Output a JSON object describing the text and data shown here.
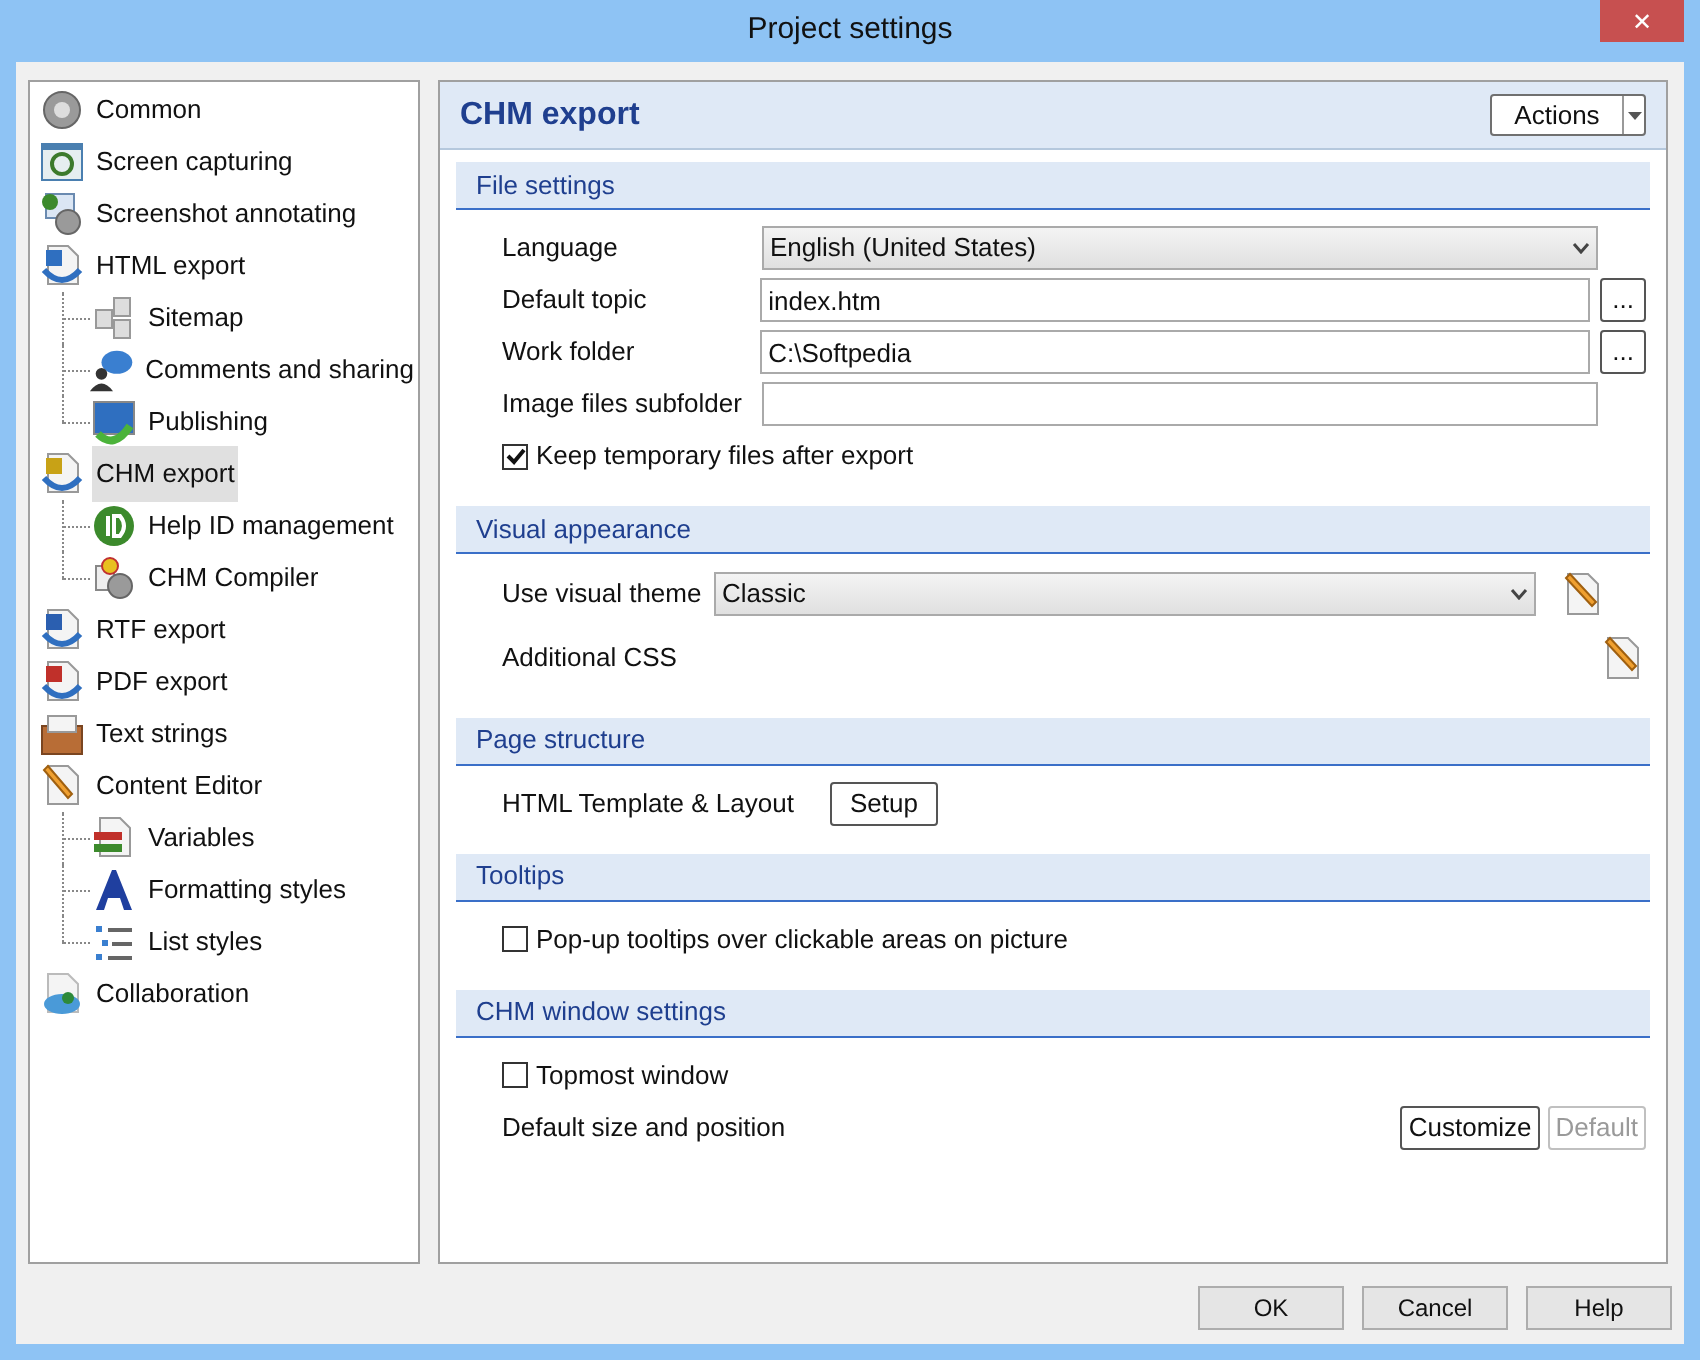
{
  "window": {
    "title": "Project settings",
    "close": "✕"
  },
  "sidebar": {
    "items": [
      {
        "label": "Common",
        "selected": false
      },
      {
        "label": "Screen capturing",
        "selected": false
      },
      {
        "label": "Screenshot annotating",
        "selected": false
      },
      {
        "label": "HTML export",
        "selected": false,
        "children": [
          {
            "label": "Sitemap",
            "selected": false
          },
          {
            "label": "Comments and sharing",
            "selected": false
          },
          {
            "label": "Publishing",
            "selected": false
          }
        ]
      },
      {
        "label": "CHM export",
        "selected": true,
        "children": [
          {
            "label": "Help ID management",
            "selected": false
          },
          {
            "label": "CHM Compiler",
            "selected": false
          }
        ]
      },
      {
        "label": "RTF export",
        "selected": false
      },
      {
        "label": "PDF export",
        "selected": false
      },
      {
        "label": "Text strings",
        "selected": false
      },
      {
        "label": "Content Editor",
        "selected": false,
        "children": [
          {
            "label": "Variables",
            "selected": false
          },
          {
            "label": "Formatting styles",
            "selected": false
          },
          {
            "label": "List styles",
            "selected": false
          }
        ]
      },
      {
        "label": "Collaboration",
        "selected": false
      }
    ]
  },
  "panel": {
    "title": "CHM export",
    "actions_button": "Actions",
    "sections": [
      {
        "title": "File settings",
        "rows": [
          {
            "kind": "select",
            "label": "Language",
            "value": "English (United States)"
          },
          {
            "kind": "browse",
            "label": "Default topic",
            "value": "index.htm",
            "button": "..."
          },
          {
            "kind": "browse",
            "label": "Work folder",
            "value": "C:\\Softpedia",
            "button": "..."
          },
          {
            "kind": "field",
            "label": "Image files subfolder"
          },
          {
            "kind": "checkbox",
            "label": "Keep temporary files after export",
            "checked": true
          }
        ]
      },
      {
        "title": "Visual appearance",
        "rows": [
          {
            "kind": "select_edit",
            "label": "Use visual theme",
            "value": "Classic"
          },
          {
            "kind": "edit",
            "label": "Additional CSS"
          }
        ]
      },
      {
        "title": "Page structure",
        "rows": [
          {
            "kind": "button",
            "label": "HTML Template & Layout",
            "button": "Setup"
          }
        ]
      },
      {
        "title": "Tooltips",
        "rows": [
          {
            "kind": "checkbox",
            "label": "Pop-up tooltips over clickable areas on picture",
            "checked": false
          }
        ]
      },
      {
        "title": "CHM window settings",
        "rows": [
          {
            "kind": "checkbox",
            "label": "Topmost window",
            "checked": false
          },
          {
            "kind": "buttons",
            "label": "Default size and position",
            "buttons": [
              {
                "label": "Customize",
                "disabled": false
              },
              {
                "label": "Default",
                "disabled": true
              }
            ]
          }
        ]
      }
    ]
  },
  "buttons": [
    "OK",
    "Cancel",
    "Help"
  ]
}
